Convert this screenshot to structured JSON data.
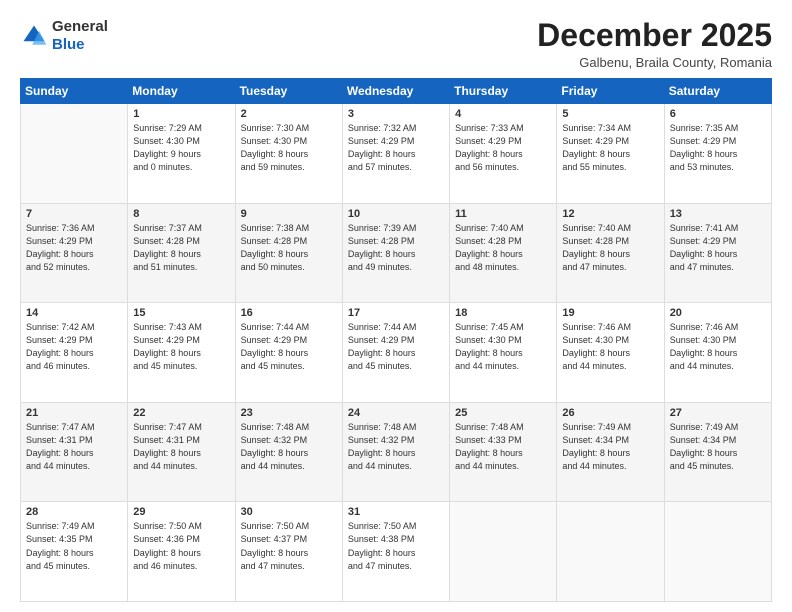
{
  "header": {
    "logo_general": "General",
    "logo_blue": "Blue",
    "month_title": "December 2025",
    "location": "Galbenu, Braila County, Romania"
  },
  "weekdays": [
    "Sunday",
    "Monday",
    "Tuesday",
    "Wednesday",
    "Thursday",
    "Friday",
    "Saturday"
  ],
  "weeks": [
    [
      {
        "day": "",
        "info": ""
      },
      {
        "day": "1",
        "info": "Sunrise: 7:29 AM\nSunset: 4:30 PM\nDaylight: 9 hours\nand 0 minutes."
      },
      {
        "day": "2",
        "info": "Sunrise: 7:30 AM\nSunset: 4:30 PM\nDaylight: 8 hours\nand 59 minutes."
      },
      {
        "day": "3",
        "info": "Sunrise: 7:32 AM\nSunset: 4:29 PM\nDaylight: 8 hours\nand 57 minutes."
      },
      {
        "day": "4",
        "info": "Sunrise: 7:33 AM\nSunset: 4:29 PM\nDaylight: 8 hours\nand 56 minutes."
      },
      {
        "day": "5",
        "info": "Sunrise: 7:34 AM\nSunset: 4:29 PM\nDaylight: 8 hours\nand 55 minutes."
      },
      {
        "day": "6",
        "info": "Sunrise: 7:35 AM\nSunset: 4:29 PM\nDaylight: 8 hours\nand 53 minutes."
      }
    ],
    [
      {
        "day": "7",
        "info": "Sunrise: 7:36 AM\nSunset: 4:29 PM\nDaylight: 8 hours\nand 52 minutes."
      },
      {
        "day": "8",
        "info": "Sunrise: 7:37 AM\nSunset: 4:28 PM\nDaylight: 8 hours\nand 51 minutes."
      },
      {
        "day": "9",
        "info": "Sunrise: 7:38 AM\nSunset: 4:28 PM\nDaylight: 8 hours\nand 50 minutes."
      },
      {
        "day": "10",
        "info": "Sunrise: 7:39 AM\nSunset: 4:28 PM\nDaylight: 8 hours\nand 49 minutes."
      },
      {
        "day": "11",
        "info": "Sunrise: 7:40 AM\nSunset: 4:28 PM\nDaylight: 8 hours\nand 48 minutes."
      },
      {
        "day": "12",
        "info": "Sunrise: 7:40 AM\nSunset: 4:28 PM\nDaylight: 8 hours\nand 47 minutes."
      },
      {
        "day": "13",
        "info": "Sunrise: 7:41 AM\nSunset: 4:29 PM\nDaylight: 8 hours\nand 47 minutes."
      }
    ],
    [
      {
        "day": "14",
        "info": "Sunrise: 7:42 AM\nSunset: 4:29 PM\nDaylight: 8 hours\nand 46 minutes."
      },
      {
        "day": "15",
        "info": "Sunrise: 7:43 AM\nSunset: 4:29 PM\nDaylight: 8 hours\nand 45 minutes."
      },
      {
        "day": "16",
        "info": "Sunrise: 7:44 AM\nSunset: 4:29 PM\nDaylight: 8 hours\nand 45 minutes."
      },
      {
        "day": "17",
        "info": "Sunrise: 7:44 AM\nSunset: 4:29 PM\nDaylight: 8 hours\nand 45 minutes."
      },
      {
        "day": "18",
        "info": "Sunrise: 7:45 AM\nSunset: 4:30 PM\nDaylight: 8 hours\nand 44 minutes."
      },
      {
        "day": "19",
        "info": "Sunrise: 7:46 AM\nSunset: 4:30 PM\nDaylight: 8 hours\nand 44 minutes."
      },
      {
        "day": "20",
        "info": "Sunrise: 7:46 AM\nSunset: 4:30 PM\nDaylight: 8 hours\nand 44 minutes."
      }
    ],
    [
      {
        "day": "21",
        "info": "Sunrise: 7:47 AM\nSunset: 4:31 PM\nDaylight: 8 hours\nand 44 minutes."
      },
      {
        "day": "22",
        "info": "Sunrise: 7:47 AM\nSunset: 4:31 PM\nDaylight: 8 hours\nand 44 minutes."
      },
      {
        "day": "23",
        "info": "Sunrise: 7:48 AM\nSunset: 4:32 PM\nDaylight: 8 hours\nand 44 minutes."
      },
      {
        "day": "24",
        "info": "Sunrise: 7:48 AM\nSunset: 4:32 PM\nDaylight: 8 hours\nand 44 minutes."
      },
      {
        "day": "25",
        "info": "Sunrise: 7:48 AM\nSunset: 4:33 PM\nDaylight: 8 hours\nand 44 minutes."
      },
      {
        "day": "26",
        "info": "Sunrise: 7:49 AM\nSunset: 4:34 PM\nDaylight: 8 hours\nand 44 minutes."
      },
      {
        "day": "27",
        "info": "Sunrise: 7:49 AM\nSunset: 4:34 PM\nDaylight: 8 hours\nand 45 minutes."
      }
    ],
    [
      {
        "day": "28",
        "info": "Sunrise: 7:49 AM\nSunset: 4:35 PM\nDaylight: 8 hours\nand 45 minutes."
      },
      {
        "day": "29",
        "info": "Sunrise: 7:50 AM\nSunset: 4:36 PM\nDaylight: 8 hours\nand 46 minutes."
      },
      {
        "day": "30",
        "info": "Sunrise: 7:50 AM\nSunset: 4:37 PM\nDaylight: 8 hours\nand 47 minutes."
      },
      {
        "day": "31",
        "info": "Sunrise: 7:50 AM\nSunset: 4:38 PM\nDaylight: 8 hours\nand 47 minutes."
      },
      {
        "day": "",
        "info": ""
      },
      {
        "day": "",
        "info": ""
      },
      {
        "day": "",
        "info": ""
      }
    ]
  ]
}
